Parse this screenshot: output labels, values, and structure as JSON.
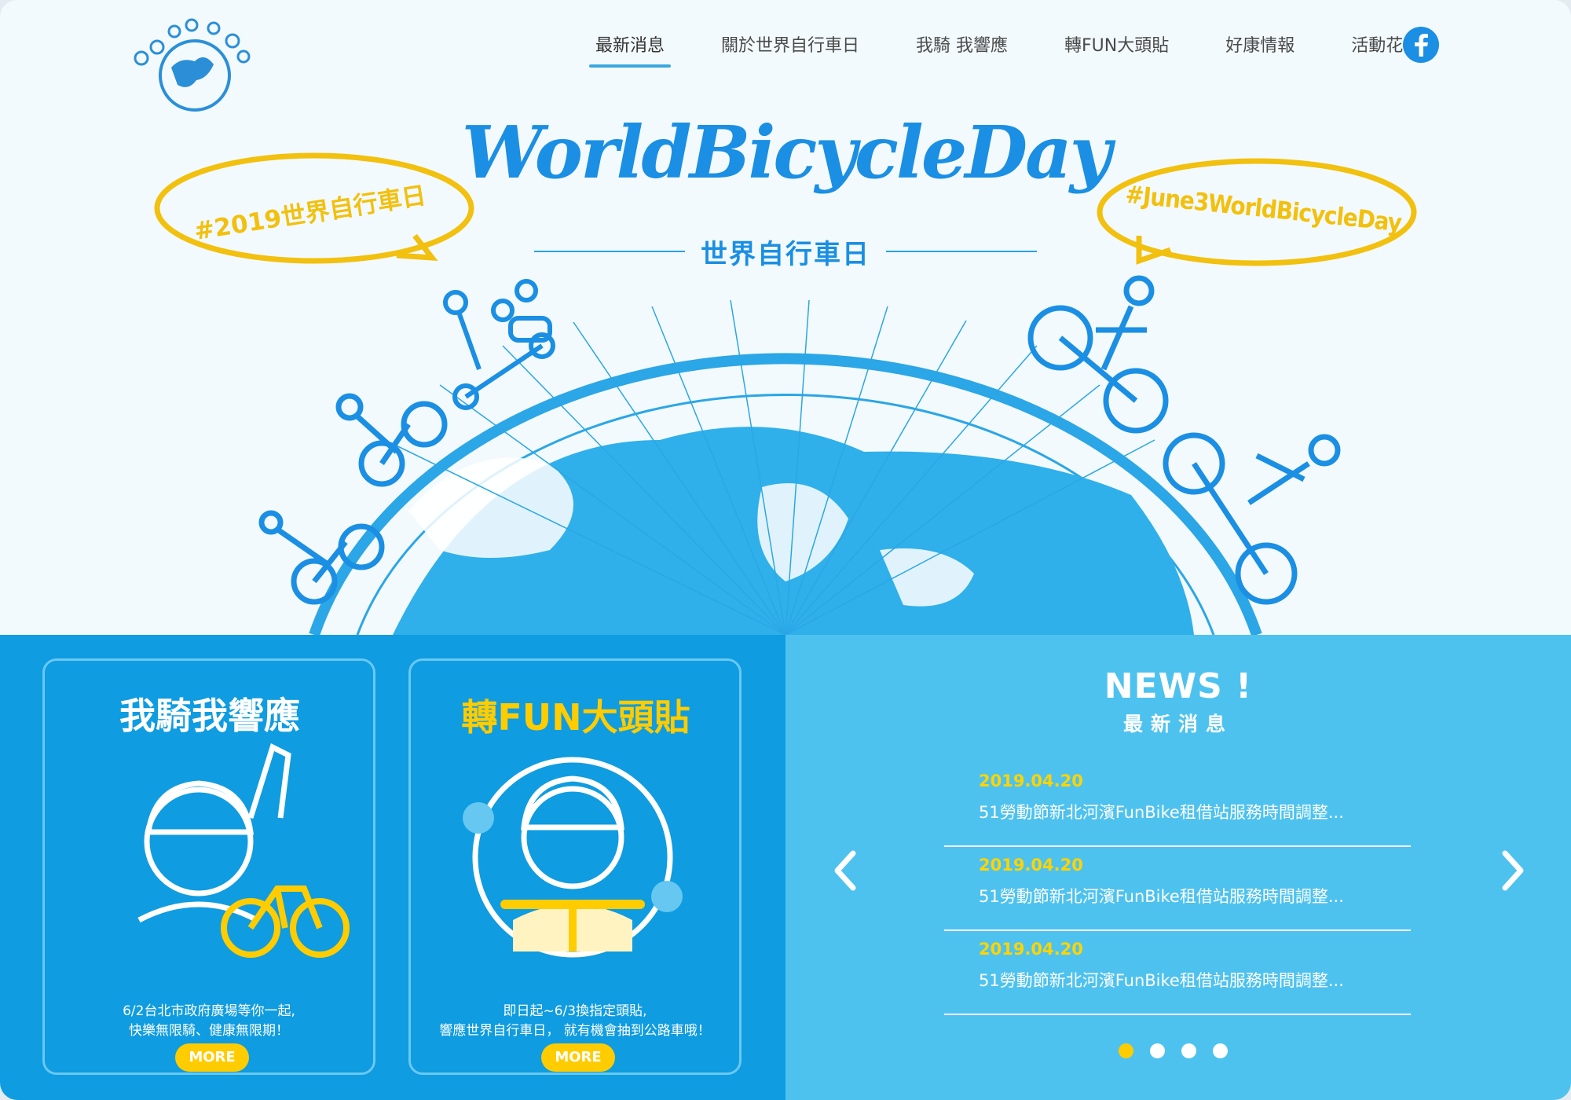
{
  "nav": {
    "items": [
      {
        "label": "最新消息",
        "active": true
      },
      {
        "label": "關於世界自行車日",
        "active": false
      },
      {
        "label": "我騎 我響應",
        "active": false
      },
      {
        "label": "轉FUN大頭貼",
        "active": false
      },
      {
        "label": "好康情報",
        "active": false
      },
      {
        "label": "活動花絮",
        "active": false
      }
    ],
    "social_icon": "facebook-icon"
  },
  "hero": {
    "title": "WorldBicycleDay",
    "subtitle": "世界自行車日",
    "bubble_left": "#2019世界自行車日",
    "bubble_right": "#June3WorldBicycleDay"
  },
  "promos": [
    {
      "art_title": "我騎我響應",
      "desc_line1": "6/2台北市政府廣場等你一起,",
      "desc_line2": "快樂無限騎、健康無限期！",
      "button": "MORE"
    },
    {
      "art_title": "轉FUN大頭貼",
      "desc_line1": "即日起~6/3換指定頭貼,",
      "desc_line2": "響應世界自行車日， 就有機會抽到公路車哦！",
      "button": "MORE"
    }
  ],
  "news": {
    "heading": "NEWS !",
    "subheading": "最新消息",
    "items": [
      {
        "date": "2019.04.20",
        "title": "51勞動節新北河濱FunBike租借站服務時間調整..."
      },
      {
        "date": "2019.04.20",
        "title": "51勞動節新北河濱FunBike租借站服務時間調整..."
      },
      {
        "date": "2019.04.20",
        "title": "51勞動節新北河濱FunBike租借站服務時間調整..."
      }
    ],
    "carousel_dots": 4,
    "active_dot": 1
  },
  "colors": {
    "brand_blue": "#1a8fe3",
    "promo_bg": "#0f9ce0",
    "news_bg": "#4ec2ef",
    "accent_yellow": "#ffcc00",
    "hero_bg": "#f3fafd"
  }
}
